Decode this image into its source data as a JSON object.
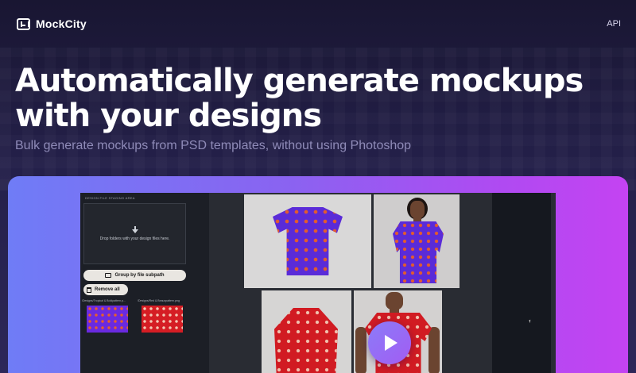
{
  "nav": {
    "brand": "MockCity",
    "api_link": "API"
  },
  "hero": {
    "title": "Automatically generate mockups with your designs",
    "subtitle": "Bulk generate mockups from PSD templates, without using Photoshop"
  },
  "demo_app": {
    "staging_label": "DESIGN FILE STAGING AREA",
    "drop_text": "Drop folders with your design files here.",
    "group_button": "Group by file subpath",
    "remove_button": "Remove all",
    "files": [
      {
        "name": "/Designs/Tropical & Boldpattern.p...",
        "thumb_color": "#6a2ae0"
      },
      {
        "name": "/Designs/Red & Beauxpattern.png",
        "thumb_color": "#d51d24"
      }
    ],
    "mockups": [
      {
        "label": "purple-tshirt-flat",
        "color": "#5a2bd8"
      },
      {
        "label": "purple-tshirt-model",
        "color": "#5a2bd8"
      },
      {
        "label": "red-hoodie",
        "color": "#d11b22"
      },
      {
        "label": "red-tshirt-model",
        "color": "#d11b22"
      }
    ]
  },
  "icons": {
    "logo": "mockcity-logo-icon",
    "download": "download-arrow-icon",
    "folder": "folder-icon",
    "trash": "trash-icon",
    "play": "play-icon"
  },
  "colors": {
    "background_top": "#191632",
    "background_bottom": "#2d2759",
    "showcase_gradient_start": "#6f7cf6",
    "showcase_gradient_end": "#c443f2",
    "subtitle": "#8f8bb8"
  }
}
